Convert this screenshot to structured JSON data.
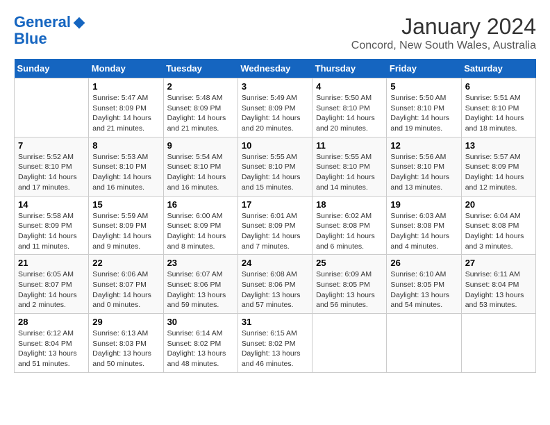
{
  "logo": {
    "line1": "General",
    "line2": "Blue"
  },
  "title": "January 2024",
  "subtitle": "Concord, New South Wales, Australia",
  "days_of_week": [
    "Sunday",
    "Monday",
    "Tuesday",
    "Wednesday",
    "Thursday",
    "Friday",
    "Saturday"
  ],
  "weeks": [
    [
      {
        "day": "",
        "info": ""
      },
      {
        "day": "1",
        "info": "Sunrise: 5:47 AM\nSunset: 8:09 PM\nDaylight: 14 hours\nand 21 minutes."
      },
      {
        "day": "2",
        "info": "Sunrise: 5:48 AM\nSunset: 8:09 PM\nDaylight: 14 hours\nand 21 minutes."
      },
      {
        "day": "3",
        "info": "Sunrise: 5:49 AM\nSunset: 8:09 PM\nDaylight: 14 hours\nand 20 minutes."
      },
      {
        "day": "4",
        "info": "Sunrise: 5:50 AM\nSunset: 8:10 PM\nDaylight: 14 hours\nand 20 minutes."
      },
      {
        "day": "5",
        "info": "Sunrise: 5:50 AM\nSunset: 8:10 PM\nDaylight: 14 hours\nand 19 minutes."
      },
      {
        "day": "6",
        "info": "Sunrise: 5:51 AM\nSunset: 8:10 PM\nDaylight: 14 hours\nand 18 minutes."
      }
    ],
    [
      {
        "day": "7",
        "info": "Sunrise: 5:52 AM\nSunset: 8:10 PM\nDaylight: 14 hours\nand 17 minutes."
      },
      {
        "day": "8",
        "info": "Sunrise: 5:53 AM\nSunset: 8:10 PM\nDaylight: 14 hours\nand 16 minutes."
      },
      {
        "day": "9",
        "info": "Sunrise: 5:54 AM\nSunset: 8:10 PM\nDaylight: 14 hours\nand 16 minutes."
      },
      {
        "day": "10",
        "info": "Sunrise: 5:55 AM\nSunset: 8:10 PM\nDaylight: 14 hours\nand 15 minutes."
      },
      {
        "day": "11",
        "info": "Sunrise: 5:55 AM\nSunset: 8:10 PM\nDaylight: 14 hours\nand 14 minutes."
      },
      {
        "day": "12",
        "info": "Sunrise: 5:56 AM\nSunset: 8:10 PM\nDaylight: 14 hours\nand 13 minutes."
      },
      {
        "day": "13",
        "info": "Sunrise: 5:57 AM\nSunset: 8:09 PM\nDaylight: 14 hours\nand 12 minutes."
      }
    ],
    [
      {
        "day": "14",
        "info": "Sunrise: 5:58 AM\nSunset: 8:09 PM\nDaylight: 14 hours\nand 11 minutes."
      },
      {
        "day": "15",
        "info": "Sunrise: 5:59 AM\nSunset: 8:09 PM\nDaylight: 14 hours\nand 9 minutes."
      },
      {
        "day": "16",
        "info": "Sunrise: 6:00 AM\nSunset: 8:09 PM\nDaylight: 14 hours\nand 8 minutes."
      },
      {
        "day": "17",
        "info": "Sunrise: 6:01 AM\nSunset: 8:09 PM\nDaylight: 14 hours\nand 7 minutes."
      },
      {
        "day": "18",
        "info": "Sunrise: 6:02 AM\nSunset: 8:08 PM\nDaylight: 14 hours\nand 6 minutes."
      },
      {
        "day": "19",
        "info": "Sunrise: 6:03 AM\nSunset: 8:08 PM\nDaylight: 14 hours\nand 4 minutes."
      },
      {
        "day": "20",
        "info": "Sunrise: 6:04 AM\nSunset: 8:08 PM\nDaylight: 14 hours\nand 3 minutes."
      }
    ],
    [
      {
        "day": "21",
        "info": "Sunrise: 6:05 AM\nSunset: 8:07 PM\nDaylight: 14 hours\nand 2 minutes."
      },
      {
        "day": "22",
        "info": "Sunrise: 6:06 AM\nSunset: 8:07 PM\nDaylight: 14 hours\nand 0 minutes."
      },
      {
        "day": "23",
        "info": "Sunrise: 6:07 AM\nSunset: 8:06 PM\nDaylight: 13 hours\nand 59 minutes."
      },
      {
        "day": "24",
        "info": "Sunrise: 6:08 AM\nSunset: 8:06 PM\nDaylight: 13 hours\nand 57 minutes."
      },
      {
        "day": "25",
        "info": "Sunrise: 6:09 AM\nSunset: 8:05 PM\nDaylight: 13 hours\nand 56 minutes."
      },
      {
        "day": "26",
        "info": "Sunrise: 6:10 AM\nSunset: 8:05 PM\nDaylight: 13 hours\nand 54 minutes."
      },
      {
        "day": "27",
        "info": "Sunrise: 6:11 AM\nSunset: 8:04 PM\nDaylight: 13 hours\nand 53 minutes."
      }
    ],
    [
      {
        "day": "28",
        "info": "Sunrise: 6:12 AM\nSunset: 8:04 PM\nDaylight: 13 hours\nand 51 minutes."
      },
      {
        "day": "29",
        "info": "Sunrise: 6:13 AM\nSunset: 8:03 PM\nDaylight: 13 hours\nand 50 minutes."
      },
      {
        "day": "30",
        "info": "Sunrise: 6:14 AM\nSunset: 8:02 PM\nDaylight: 13 hours\nand 48 minutes."
      },
      {
        "day": "31",
        "info": "Sunrise: 6:15 AM\nSunset: 8:02 PM\nDaylight: 13 hours\nand 46 minutes."
      },
      {
        "day": "",
        "info": ""
      },
      {
        "day": "",
        "info": ""
      },
      {
        "day": "",
        "info": ""
      }
    ]
  ]
}
